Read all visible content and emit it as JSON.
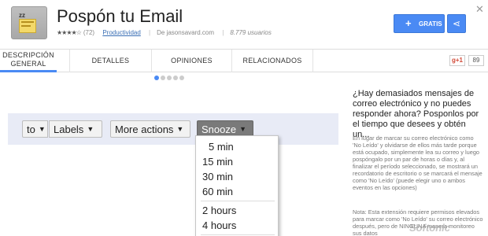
{
  "header": {
    "title": "Pospón tu Email",
    "rating_stars": "★★★★☆",
    "rating_count": "(72)",
    "category": "Productividad",
    "author": "De jasonsavard.com",
    "users": "8.779 usuarios",
    "free_button": "GRATIS",
    "free_icon": "+",
    "share_icon": "⋖",
    "close_icon": "✕",
    "icon_zz": "zz"
  },
  "tabs": [
    {
      "label": "DESCRIPCIÓN\nGENERAL"
    },
    {
      "label": "DETALLES"
    },
    {
      "label": "OPINIONES"
    },
    {
      "label": "RELACIONADOS"
    }
  ],
  "social": {
    "gplus_label": "g+1",
    "gplus_count": "89"
  },
  "carousel": {
    "total": 5,
    "active_index": 0
  },
  "screenshot": {
    "to_button": "to",
    "labels_button": "Labels",
    "more_button": "More actions",
    "snooze_button": "Snooze",
    "dropdown_arrow": "▼",
    "snooze_options": [
      "5 min",
      "15 min",
      "30 min",
      "60 min",
      "2 hours",
      "4 hours"
    ]
  },
  "description": {
    "title": "¿Hay demasiados mensajes de correo electrónico y no puedes responder ahora? Posponlos por el tiempo que desees y obtén un...",
    "body": "En lugar de marcar su correo electrónico como 'No Leído' y olvidarse de ellos más tarde porque está ocupado, simplemente lea su correo y luego pospóngalo por un par de horas o días y, al finalizar el período seleccionado, se mostrará un recordatorio de escritorio o se marcará el mensaje como 'No Leído' (puede elegir uno o ambos eventos en las opciones)",
    "note": "Nota: Esta extensión requiere permisos elevados para marcar como 'No Leído' su correo electrónico después, pero de NINGUNA manera monitoreo sus datos"
  },
  "watermark": "Softonic",
  "colors": {
    "accent": "#4a8af4",
    "snooze_bg": "#7a7a7a",
    "toolbar_bg": "#e8ebf6"
  }
}
